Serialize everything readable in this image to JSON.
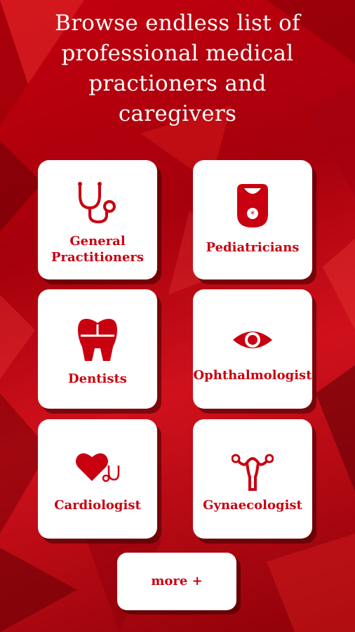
{
  "header": {
    "lines": [
      "Browse endless list of",
      "professional medical",
      "practioners and",
      "caregivers"
    ]
  },
  "categories": [
    {
      "label_lines": [
        "General",
        "Practitioners"
      ],
      "icon": "stethoscope-icon"
    },
    {
      "label_lines": [
        "Pediatricians"
      ],
      "icon": "baby-bib-icon"
    },
    {
      "label_lines": [
        "Dentists"
      ],
      "icon": "tooth-icon"
    },
    {
      "label_lines": [
        "Ophthalmologist"
      ],
      "icon": "eye-icon"
    },
    {
      "label_lines": [
        "Cardiologist"
      ],
      "icon": "heart-stethoscope-icon"
    },
    {
      "label_lines": [
        "Gynaecologist"
      ],
      "icon": "uterus-icon"
    }
  ],
  "more_button": {
    "label": "more +"
  },
  "colors": {
    "accent": "#c8000f",
    "background": "#b5000d",
    "card": "#ffffff"
  }
}
